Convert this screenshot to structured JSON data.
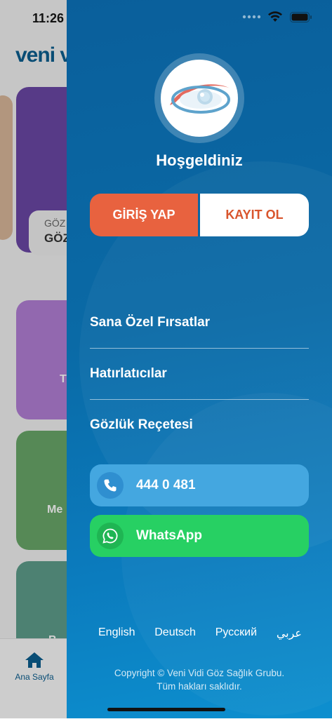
{
  "status": {
    "time": "11:26"
  },
  "background": {
    "logo": "veni v",
    "card_small_line1": "GÖZ",
    "card_small_line2": "GÖZ",
    "tile1_letter": "T",
    "tile2_label": "Me",
    "tile3_label": "B",
    "tab_home_label": "Ana Sayfa"
  },
  "drawer": {
    "welcome": "Hoşgeldiniz",
    "login_label": "GİRİŞ YAP",
    "register_label": "KAYIT OL",
    "menu": [
      {
        "label": "Sana Özel Fırsatlar"
      },
      {
        "label": "Hatırlatıcılar"
      },
      {
        "label": "Gözlük Reçetesi"
      }
    ],
    "phone_label": "444 0 481",
    "whatsapp_label": "WhatsApp",
    "languages": [
      "English",
      "Deutsch",
      "Русский",
      "عربي"
    ],
    "copyright_line1": "Copyright © Veni Vidi Göz Sağlık Grubu.",
    "copyright_line2": "Tüm hakları saklıdır."
  },
  "colors": {
    "drawer": "#0a6aa6",
    "login": "#e8623f",
    "register_text": "#d9552d",
    "phone": "#44a7e0",
    "whatsapp": "#27d063"
  }
}
